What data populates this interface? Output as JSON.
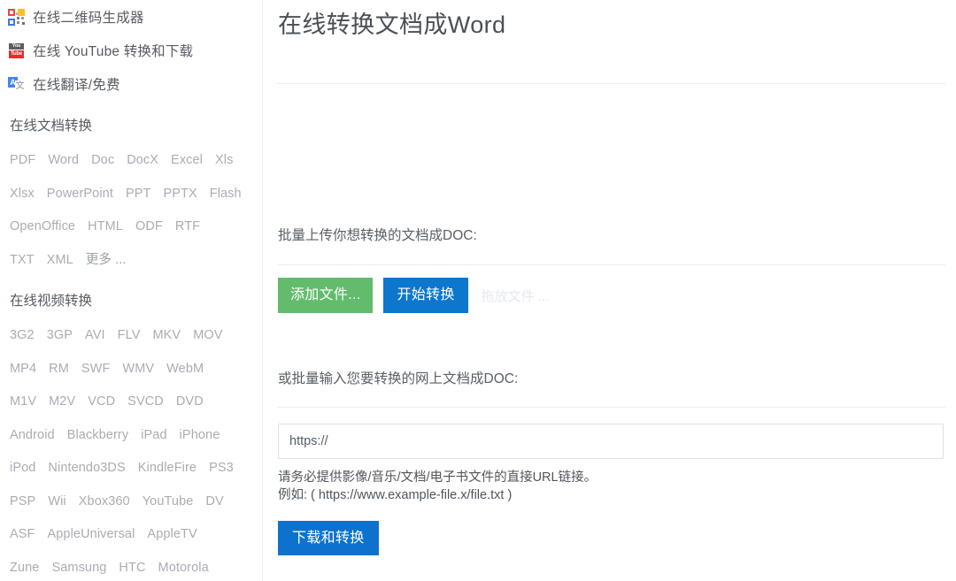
{
  "sidebar": {
    "promo_items": [
      {
        "icon": "qr-code-icon",
        "label": "在线二维码生成器"
      },
      {
        "icon": "youtube-icon",
        "label": "在线 YouTube 转换和下载",
        "icon_top": "You",
        "icon_bottom": "Tube"
      },
      {
        "icon": "translate-icon",
        "label": "在线翻译/免费",
        "icon_letter": "A",
        "icon_glyph": "文"
      }
    ],
    "doc_section": {
      "heading": "在线文档转换",
      "rows": [
        [
          "PDF",
          "Word",
          "Doc",
          "DocX",
          "Excel",
          "Xls"
        ],
        [
          "Xlsx",
          "PowerPoint",
          "PPT",
          "PPTX",
          "Flash"
        ],
        [
          "OpenOffice",
          "HTML",
          "ODF",
          "RTF"
        ],
        [
          "TXT",
          "XML",
          "更多 ..."
        ]
      ]
    },
    "video_section": {
      "heading": "在线视频转换",
      "rows": [
        [
          "3G2",
          "3GP",
          "AVI",
          "FLV",
          "MKV",
          "MOV"
        ],
        [
          "MP4",
          "RM",
          "SWF",
          "WMV",
          "WebM"
        ],
        [
          "M1V",
          "M2V",
          "VCD",
          "SVCD",
          "DVD"
        ],
        [
          "Android",
          "Blackberry",
          "iPad",
          "iPhone"
        ],
        [
          "iPod",
          "Nintendo3DS",
          "KindleFire",
          "PS3"
        ],
        [
          "PSP",
          "Wii",
          "Xbox360",
          "YouTube",
          "DV"
        ],
        [
          "ASF",
          "AppleUniversal",
          "AppleTV"
        ],
        [
          "Zune",
          "Samsung",
          "HTC",
          "Motorola"
        ]
      ]
    }
  },
  "main": {
    "title": "在线转换文档成Word",
    "upload": {
      "label": "批量上传你想转换的文档成DOC:",
      "add_files_button": "添加文件...",
      "start_convert_button": "开始转换",
      "dropzone_hint": "拖放文件 ..."
    },
    "url": {
      "label": "或批量输入您要转换的网上文档成DOC:",
      "input_value": "https://",
      "input_placeholder": "https://",
      "hint_line1": "请务必提供影像/音乐/文档/电子书文件的直接URL链接。",
      "hint_line2": "例如: ( https://www.example-file.x/file.txt )",
      "download_button": "下载和转换"
    }
  },
  "colors": {
    "green_button": "#63bb6c",
    "blue_button": "#0d76cd",
    "divider": "#ededed",
    "chip_text": "#a8adb3",
    "body_text": "#555c63"
  }
}
